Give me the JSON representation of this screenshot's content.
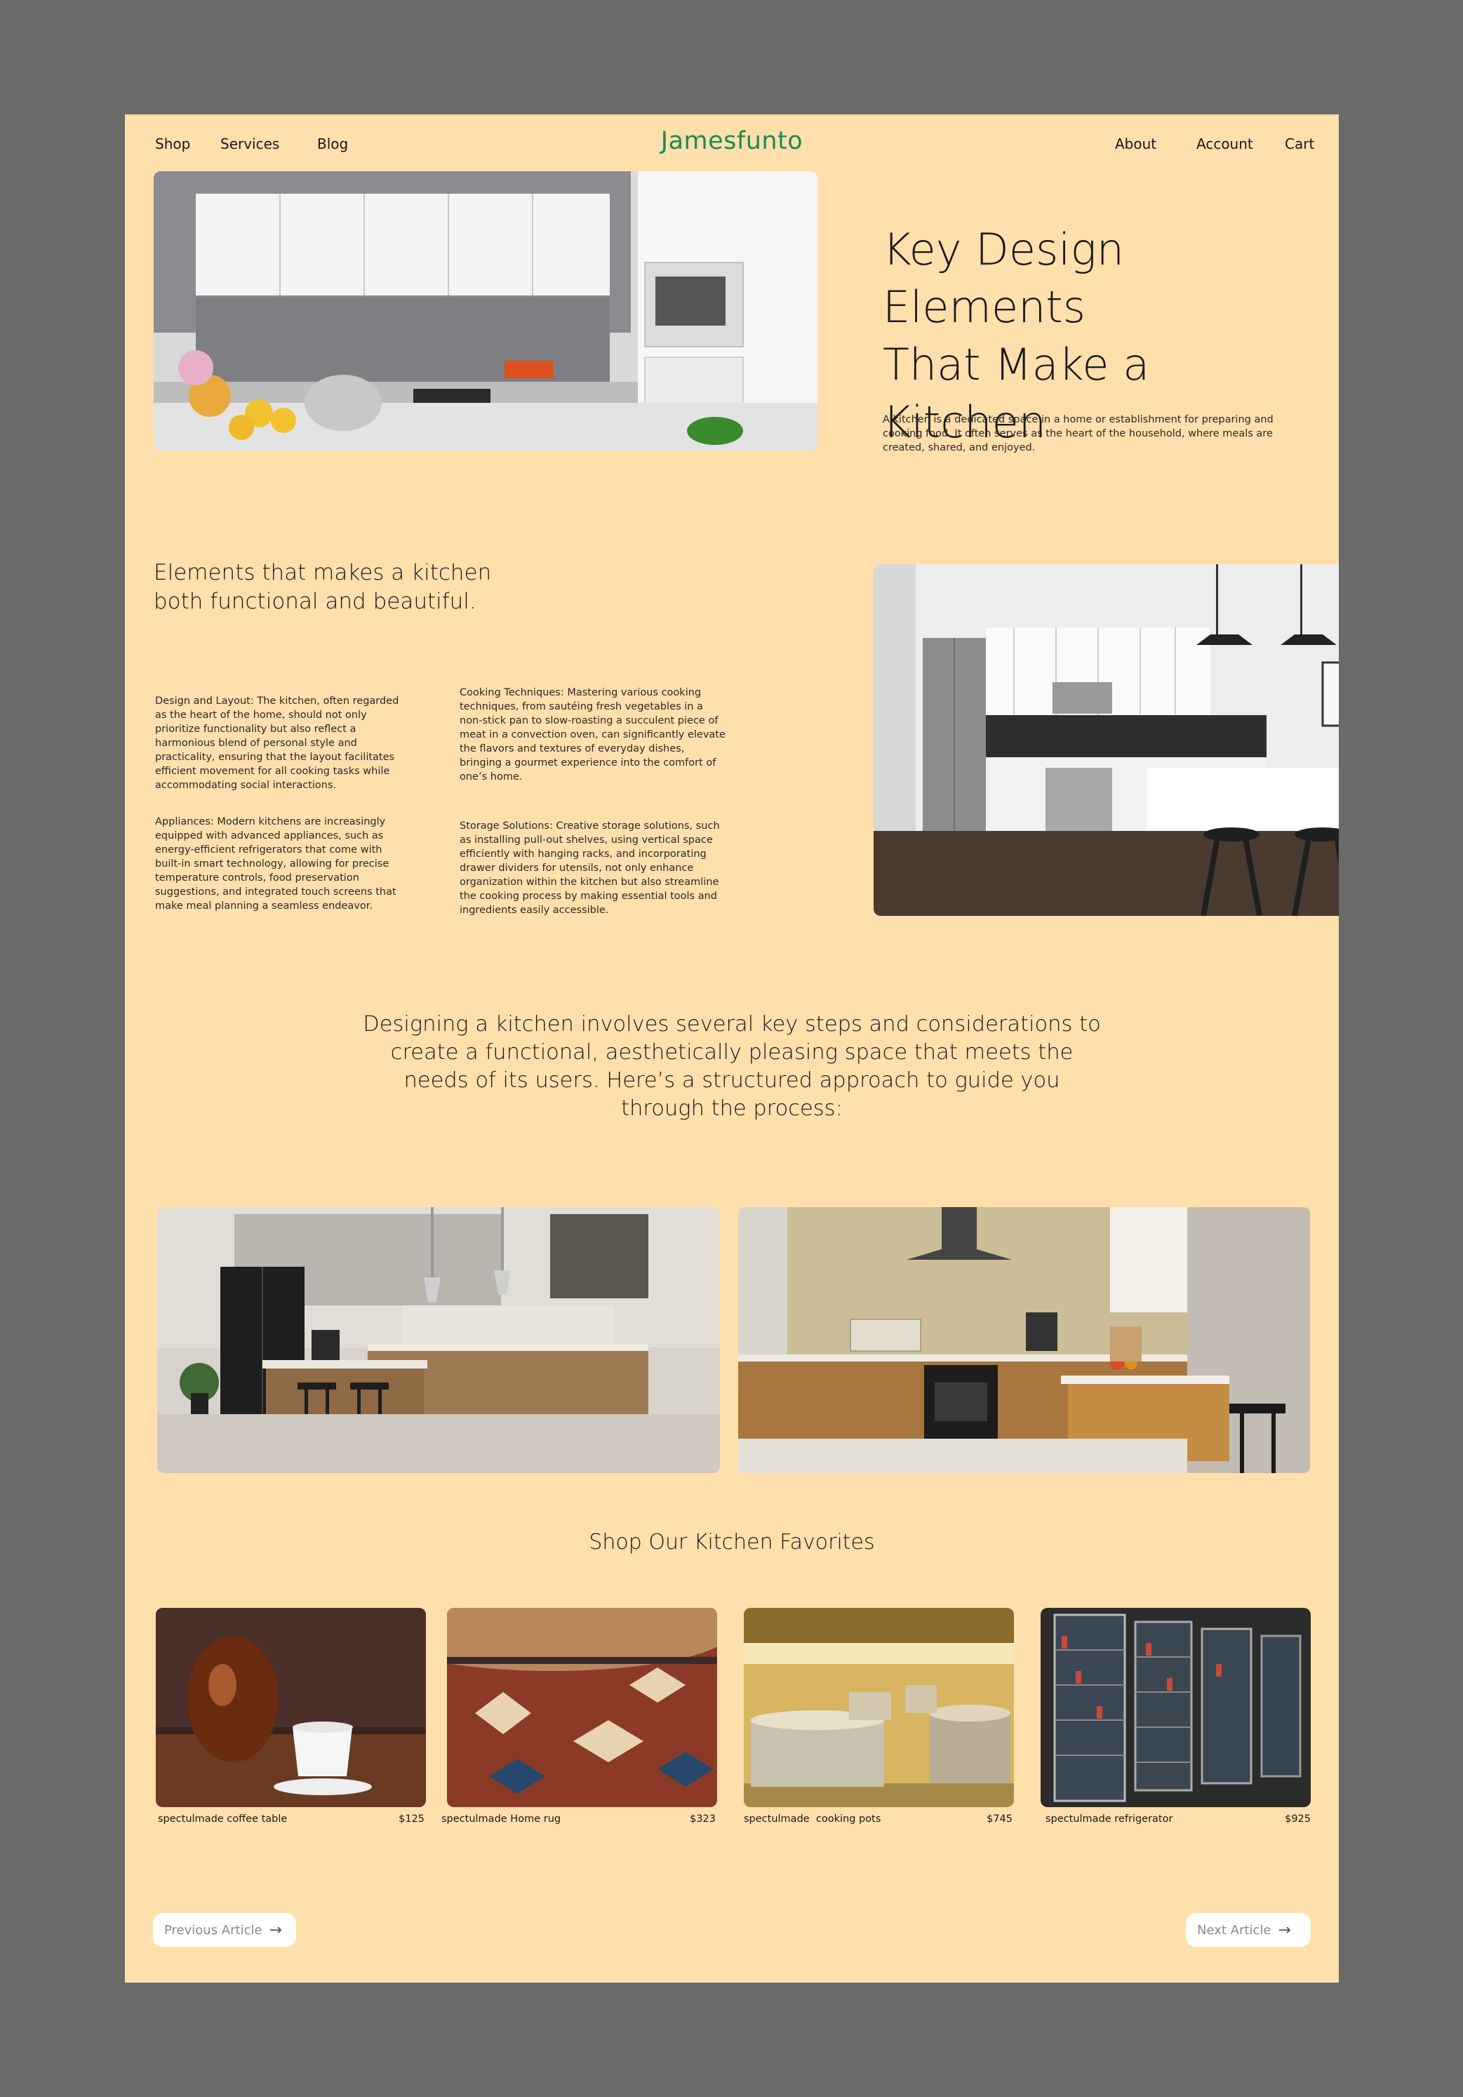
{
  "nav": {
    "left": [
      "Shop",
      "Services",
      "Blog"
    ],
    "brand": "Jamesfunto",
    "right": [
      "About",
      "Account",
      "Cart"
    ]
  },
  "hero": {
    "title_line1": "Key Design Elements",
    "title_line2": "That Make a Kitchen",
    "description": "A kitchen is a dedicated space in a home or establishment for preparing and cooking food. It often serves as the heart of the household, where meals are created, shared, and enjoyed."
  },
  "elements": {
    "title_line1": "Elements that makes a kitchen",
    "title_line2": "both functional and beautiful.",
    "design_layout": "Design and Layout: The kitchen, often regarded as the heart of the home, should not only prioritize functionality but also reflect a harmonious blend of personal style and practicality, ensuring that the layout facilitates efficient movement for all cooking tasks while accommodating social interactions.",
    "appliances": "Appliances: Modern kitchens are increasingly equipped with advanced appliances, such as energy-efficient refrigerators that come with built-in smart technology, allowing for precise temperature controls, food preservation suggestions, and integrated touch screens that make meal planning a seamless endeavor.",
    "cooking": "Cooking Techniques: Mastering various cooking techniques, from sautéing fresh vegetables in a non-stick pan to slow-roasting a succulent piece of meat in a convection oven, can significantly elevate the flavors and textures of everyday dishes, bringing a gourmet experience into the comfort of one’s home.",
    "storage": "Storage Solutions: Creative storage solutions, such as installing pull-out shelves, using vertical space efficiently with hanging racks, and incorporating drawer dividers for utensils, not only enhance organization within the kitchen but also streamline the cooking process by making essential tools and ingredients easily accessible."
  },
  "designing": {
    "text": "Designing a kitchen involves several key steps and considerations to create a functional, aesthetically pleasing space that meets the needs of its users. Here’s a structured approach to guide you through the process:"
  },
  "shop": {
    "title": "Shop Our Kitchen Favorites",
    "products": [
      {
        "name": "spectulmade coffee table",
        "price": "$125"
      },
      {
        "name": "spectulmade Home rug",
        "price": "$323"
      },
      {
        "name": "spectulmade  cooking pots",
        "price": "$745"
      },
      {
        "name": "spectulmade refrigerator",
        "price": "$925"
      }
    ]
  },
  "pagination": {
    "previous": "Previous Article",
    "next": "Next Article"
  },
  "icons": {
    "arrow": "arrow-right-icon"
  },
  "colors": {
    "page_bg": "#ffdfab",
    "outer_bg": "#6a6a6a",
    "brand": "#1b8a55"
  }
}
